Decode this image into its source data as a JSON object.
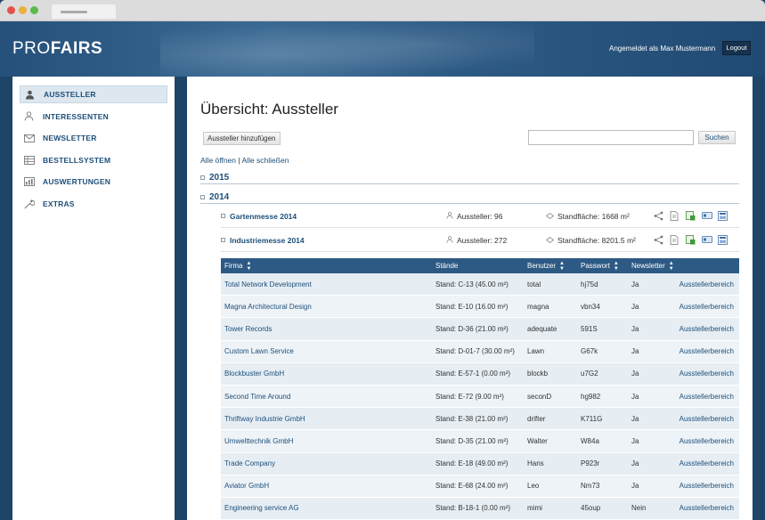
{
  "header": {
    "logo_pro": "PRO",
    "logo_fairs": "FAIRS",
    "login_text": "Angemeldet als Max Mustermann",
    "logout_label": "Logout"
  },
  "sidebar": {
    "items": [
      {
        "label": "AUSSTELLER",
        "icon": "user-icon"
      },
      {
        "label": "INTERESSENTEN",
        "icon": "user-outline-icon"
      },
      {
        "label": "NEWSLETTER",
        "icon": "envelope-icon"
      },
      {
        "label": "BESTELLSYSTEM",
        "icon": "grid-icon"
      },
      {
        "label": "AUSWERTUNGEN",
        "icon": "chart-icon"
      },
      {
        "label": "EXTRAS",
        "icon": "wrench-icon"
      }
    ]
  },
  "main": {
    "title": "Übersicht: Aussteller",
    "add_label": "Aussteller hinzufügen",
    "search_placeholder": "",
    "search_label": "Suchen",
    "open_all": "Alle öffnen",
    "separator": "|",
    "close_all": "Alle schließen",
    "years": [
      "2015",
      "2014"
    ],
    "events": [
      {
        "name": "Gartenmesse 2014",
        "aussteller": "Aussteller: 96",
        "flaeche": "Standfläche: 1668 m²"
      },
      {
        "name": "Industriemesse 2014",
        "aussteller": "Aussteller: 272",
        "flaeche": "Standfläche: 8201.5 m²"
      }
    ]
  },
  "table": {
    "headers": [
      "Firma",
      "Stände",
      "Benutzer",
      "Passwort",
      "Newsletter"
    ],
    "rows": [
      [
        "Total Network Development",
        "Stand: C-13 (45.00 m²)",
        "total",
        "hj75d",
        "Ja",
        "Ausstellerbereich"
      ],
      [
        "Magna Architectural Design",
        "Stand: E-10 (16.00 m²)",
        "magna",
        "vbn34",
        "Ja",
        "Ausstellerbereich"
      ],
      [
        "Tower Records",
        "Stand: D-36 (21.00 m²)",
        "adequate",
        "591S",
        "Ja",
        "Ausstellerbereich"
      ],
      [
        "Custom Lawn Service",
        "Stand: D-01-7 (30.00 m²)",
        "Lawn",
        "G67k",
        "Ja",
        "Ausstellerbereich"
      ],
      [
        "Blockbuster GmbH",
        "Stand: E-57-1 (0.00 m²)",
        "blockb",
        "u7G2",
        "Ja",
        "Ausstellerbereich"
      ],
      [
        "Second Time Around",
        "Stand: E-72 (9.00 m²)",
        "seconD",
        "hg982",
        "Ja",
        "Ausstellerbereich"
      ],
      [
        "Thriftway Industrie GmbH",
        "Stand: E-38 (21.00 m²)",
        "drifter",
        "K711G",
        "Ja",
        "Ausstellerbereich"
      ],
      [
        "Umwelttechnik GmbH",
        "Stand: D-35 (21.00 m²)",
        "Walter",
        "W84a",
        "Ja",
        "Ausstellerbereich"
      ],
      [
        "Trade Company",
        "Stand: E-18 (49.00 m²)",
        "Hans",
        "P923r",
        "Ja",
        "Ausstellerbereich"
      ],
      [
        "Aviator GmbH",
        "Stand: E-68 (24.00 m²)",
        "Leo",
        "Nm73",
        "Ja",
        "Ausstellerbereich"
      ],
      [
        "Engineering service AG",
        "Stand: B-18-1 (0.00 m²)",
        "mimi",
        "45oup",
        "Nein",
        "Ausstellerbereich"
      ]
    ]
  },
  "colors": {
    "header_bg": "#25507a",
    "link": "#1d4f7a",
    "table_head": "#2d5a84"
  }
}
